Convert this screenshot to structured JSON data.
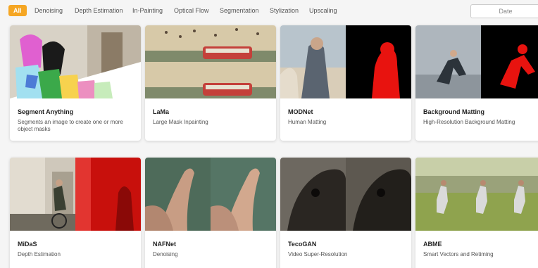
{
  "filters": {
    "chips": [
      "All",
      "Denoising",
      "Depth Estimation",
      "In-Painting",
      "Optical Flow",
      "Segmentation",
      "Stylization",
      "Upscaling"
    ],
    "active": "All",
    "date_label": "Date"
  },
  "cards": [
    {
      "title": "Segment Anything",
      "desc": "Segments an image to create one or more object masks",
      "thumb": "segment-anything-thumbnail"
    },
    {
      "title": "LaMa",
      "desc": "Large Mask Inpainting",
      "thumb": "lama-thumbnail"
    },
    {
      "title": "MODNet",
      "desc": "Human Matting",
      "thumb": "modnet-thumbnail"
    },
    {
      "title": "Background Matting",
      "desc": "High-Resolution Background Matting",
      "thumb": "background-matting-thumbnail"
    },
    {
      "title": "MiDaS",
      "desc": "Depth Estimation",
      "thumb": "midas-thumbnail"
    },
    {
      "title": "NAFNet",
      "desc": "Denoising",
      "thumb": "nafnet-thumbnail"
    },
    {
      "title": "TecoGAN",
      "desc": "Video Super-Resolution",
      "thumb": "tecogan-thumbnail"
    },
    {
      "title": "ABME",
      "desc": "Smart Vectors and Retiming",
      "thumb": "abme-thumbnail"
    }
  ],
  "colors": {
    "accent": "#f5a623",
    "mask_red": "#e8130f"
  }
}
